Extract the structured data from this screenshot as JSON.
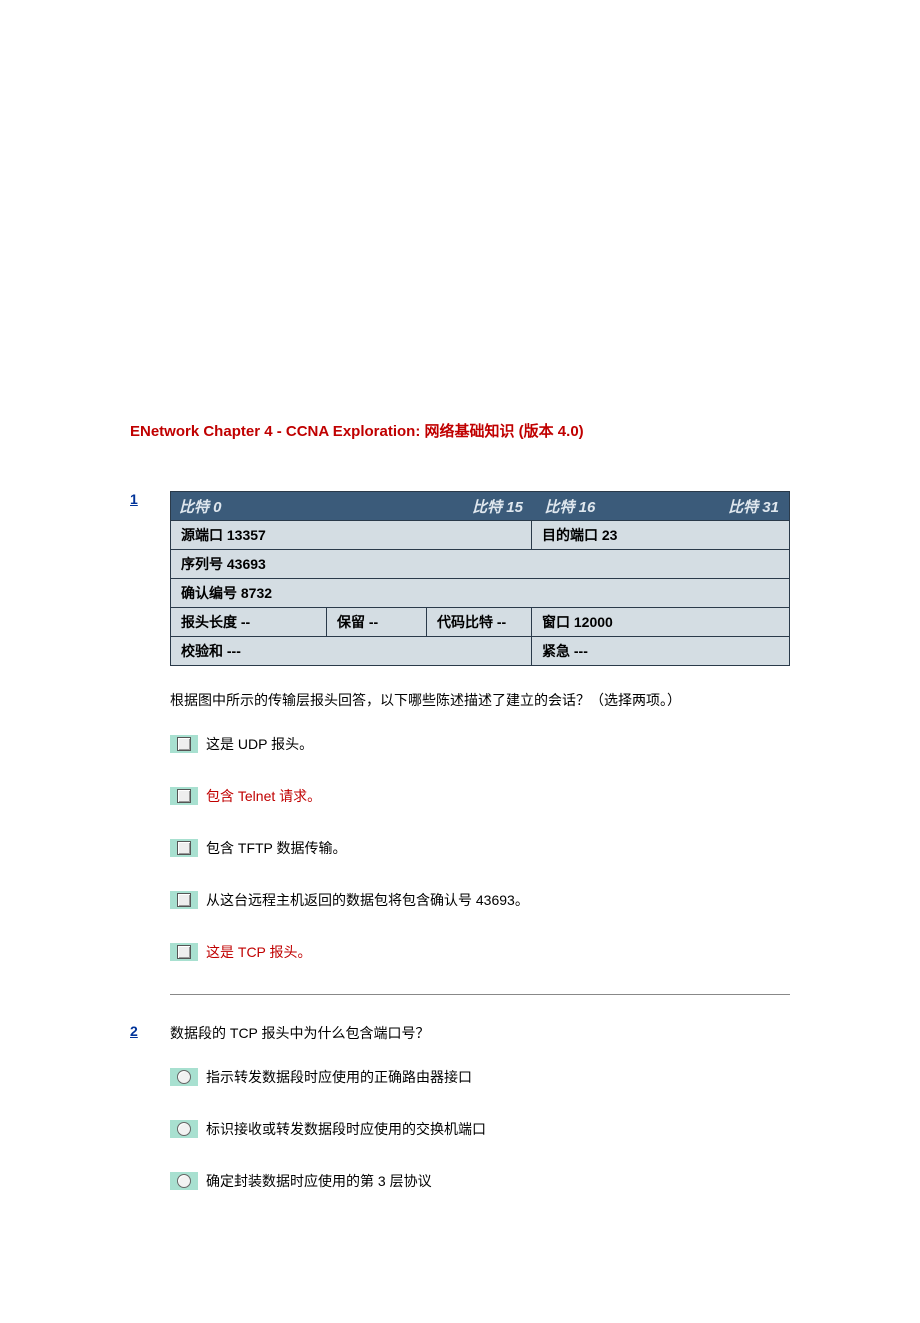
{
  "title": "ENetwork Chapter 4 - CCNA Exploration: 网络基础知识 (版本 4.0)",
  "q1": {
    "num": "1",
    "header": {
      "bit0": "比特 0",
      "bit15": "比特 15",
      "bit16": "比特 16",
      "bit31": "比特 31",
      "src_port": "源端口   13357",
      "dst_port": "目的端口   23",
      "seq": "序列号   43693",
      "ack": "确认编号   8732",
      "hlen": "报头长度 --",
      "reserved": "保留 --",
      "code": "代码比特 --",
      "window": "窗口   12000",
      "checksum": "校验和 ---",
      "urgent": "紧急 ---"
    },
    "text": "根据图中所示的传输层报头回答，以下哪些陈述描述了建立的会话？（选择两项。）",
    "opts": [
      {
        "label": "这是 UDP 报头。",
        "correct": false
      },
      {
        "label": "包含 Telnet 请求。",
        "correct": true
      },
      {
        "label": "包含 TFTP 数据传输。",
        "correct": false
      },
      {
        "label": "从这台远程主机返回的数据包将包含确认号 43693。",
        "correct": false
      },
      {
        "label": "这是 TCP 报头。",
        "correct": true
      }
    ]
  },
  "q2": {
    "num": "2",
    "text": "数据段的 TCP 报头中为什么包含端口号？",
    "opts": [
      {
        "label": "指示转发数据段时应使用的正确路由器接口"
      },
      {
        "label": "标识接收或转发数据段时应使用的交换机端口"
      },
      {
        "label": "确定封装数据时应使用的第 3 层协议"
      }
    ]
  }
}
